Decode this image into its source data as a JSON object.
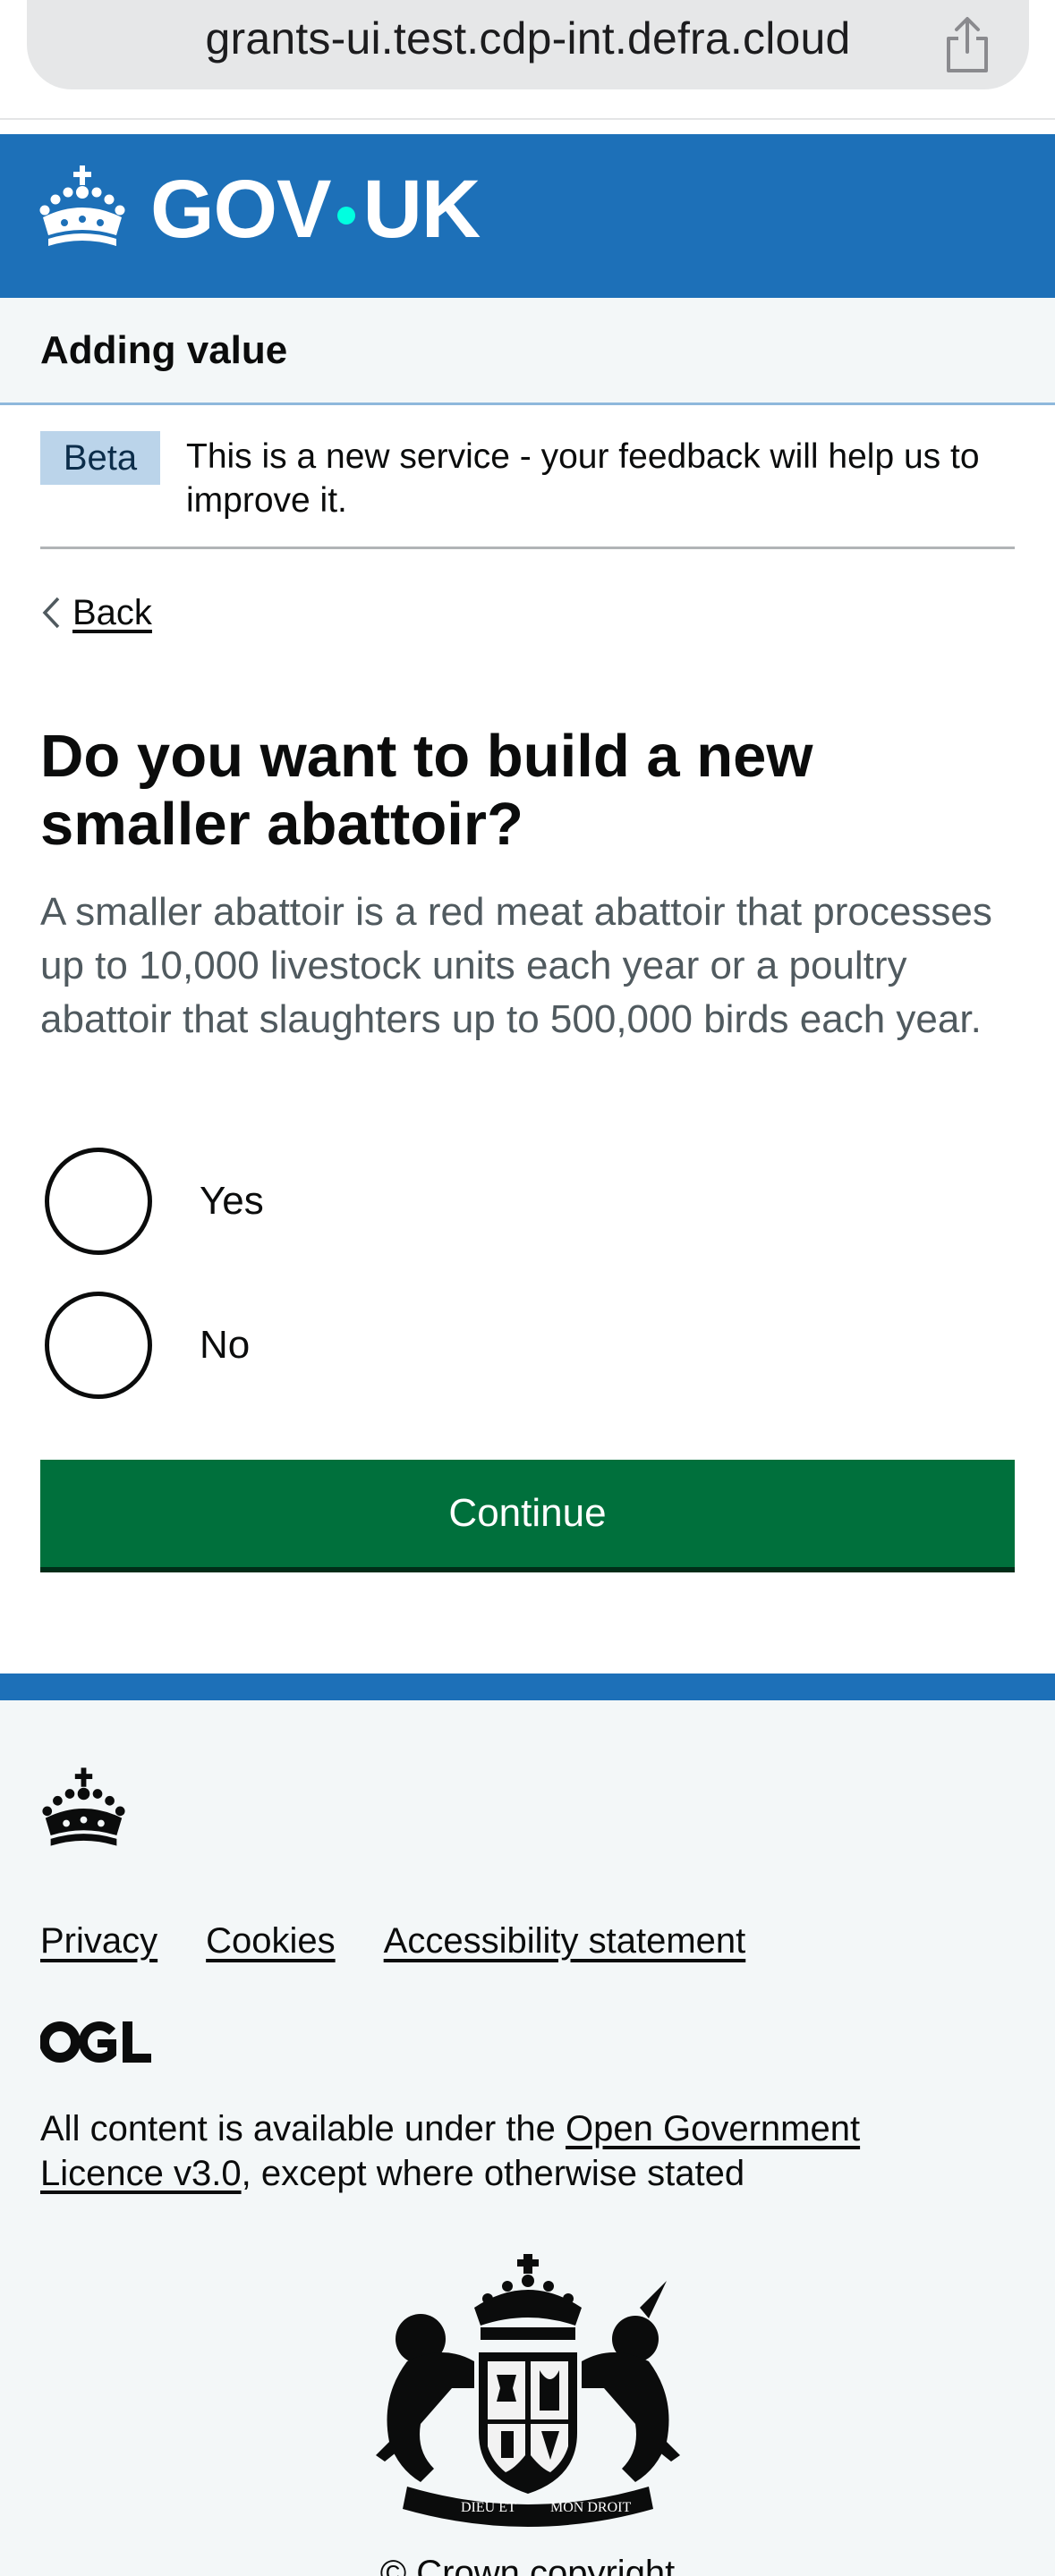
{
  "browser": {
    "url": "grants-ui.test.cdp-int.defra.cloud"
  },
  "header": {
    "logo_text_left": "GOV",
    "logo_text_right": "UK"
  },
  "service": {
    "name": "Adding value"
  },
  "phase_banner": {
    "tag": "Beta",
    "text": "This is a new service - your feedback will help us to improve it."
  },
  "back_link": {
    "label": "Back"
  },
  "question": {
    "heading": "Do you want to build a new smaller abattoir?",
    "hint": "A smaller abattoir is a red meat abattoir that processes up to 10,000 livestock units each year or a poultry abattoir that slaughters up to 500,000 birds each year.",
    "options": [
      {
        "label": "Yes",
        "selected": false
      },
      {
        "label": "No",
        "selected": false
      }
    ]
  },
  "actions": {
    "continue_label": "Continue"
  },
  "footer": {
    "links": [
      "Privacy",
      "Cookies",
      "Accessibility statement"
    ],
    "licence_prefix": "All content is available under the ",
    "licence_link": "Open Government Licence v3.0",
    "licence_suffix": ", except where otherwise stated",
    "copyright": "© Crown copyright"
  },
  "colors": {
    "header_blue": "#1d70b8",
    "button_green": "#00703c",
    "dot_turquoise": "#00ffe0",
    "light_background": "#f3f7f8"
  }
}
